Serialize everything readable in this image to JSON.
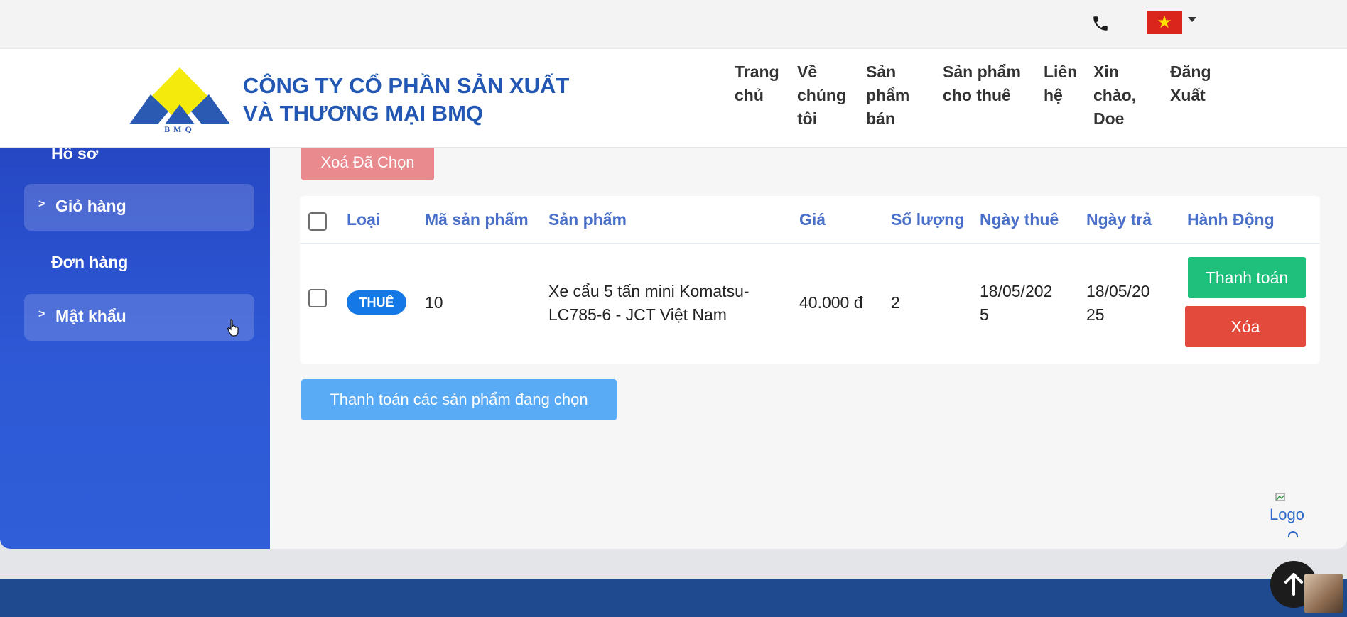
{
  "header": {
    "company_line1": "CÔNG TY CỔ PHẦN SẢN XUẤT",
    "company_line2": "VÀ THƯƠNG MẠI BMQ",
    "logo_text": "BMQ",
    "nav": [
      {
        "line1": "Trang",
        "line2": "chủ",
        "line3": ""
      },
      {
        "line1": "Về",
        "line2": "chúng",
        "line3": "tôi"
      },
      {
        "line1": "Sản",
        "line2": "phẩm",
        "line3": "bán"
      },
      {
        "line1": "Sản phẩm",
        "line2": "cho thuê",
        "line3": ""
      },
      {
        "line1": "Liên",
        "line2": "hệ",
        "line3": ""
      },
      {
        "line1": "Xin",
        "line2": "chào,",
        "line3": "Doe"
      },
      {
        "line1": "Đăng",
        "line2": "Xuất",
        "line3": ""
      }
    ]
  },
  "topbar": {
    "phone_icon": "phone-icon",
    "flag": "vietnam-flag",
    "flag_star": "★"
  },
  "sidebar": {
    "items": [
      {
        "label": "Hồ sơ"
      },
      {
        "label": "Giỏ hàng",
        "chevron": ">"
      },
      {
        "label": "Đơn hàng"
      },
      {
        "label": "Mật khẩu",
        "chevron": ">"
      }
    ]
  },
  "cart": {
    "delete_selected": "Xoá Đã Chọn",
    "columns": [
      "Loại",
      "Mã sản phẩm",
      "Sản phẩm",
      "Giá",
      "Số lượng",
      "Ngày thuê",
      "Ngày trả",
      "Hành Động"
    ],
    "rows": [
      {
        "type": "THUÊ",
        "code": "10",
        "product_line1": "Xe cẩu 5 tấn mini Komatsu-",
        "product_line2": "LC785-6 - JCT Việt Nam",
        "price": "40.000 đ",
        "qty": "2",
        "rent_line1": "18/05/202",
        "rent_line2": "5",
        "return_line1": "18/05/20",
        "return_line2": "25",
        "pay_label": "Thanh toán",
        "delete_label": "Xóa"
      }
    ],
    "pay_selected": "Thanh toán các sản phẩm đang chọn"
  },
  "broken_image": {
    "alt": "Logo"
  },
  "colors": {
    "brand_blue": "#2257b4",
    "sidebar": "#2b52d0",
    "success": "#1fbf7c",
    "danger": "#e44a3b",
    "badge": "#1478e6"
  }
}
